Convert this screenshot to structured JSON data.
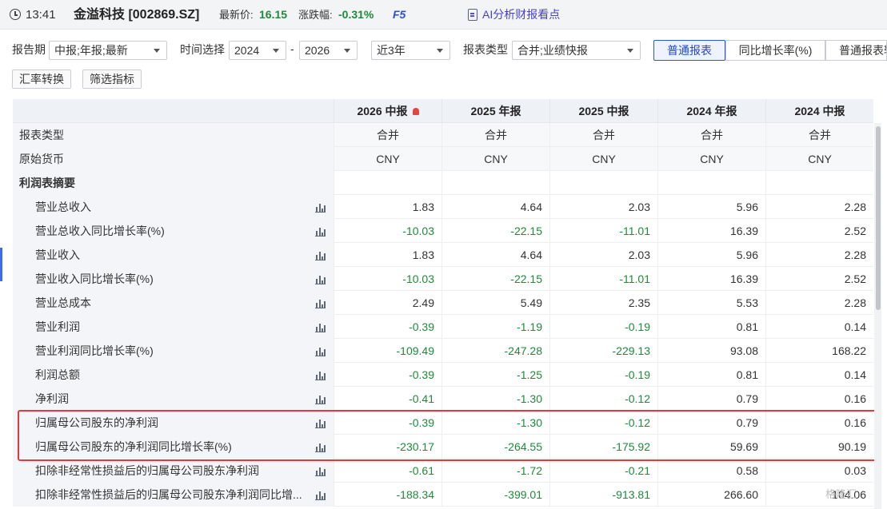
{
  "header": {
    "time": "13:41",
    "stock": "金溢科技 [002869.SZ]",
    "price_label": "最新价:",
    "price_value": "16.15",
    "change_label": "涨跌幅:",
    "change_value": "-0.31%",
    "f5": "F5",
    "ai_link": "AI分析财报看点"
  },
  "filters": {
    "period_label": "报告期",
    "period_value": "中报;年报;最新",
    "time_label": "时间选择",
    "year_from": "2024",
    "dash": "-",
    "year_to": "2026",
    "range_value": "近3年",
    "type_label": "报表类型",
    "type_value": "合并;业绩快报",
    "tabs": [
      "普通报表",
      "同比增长率(%)",
      "普通报表转"
    ]
  },
  "buttons": {
    "currency": "汇率转换",
    "filter": "筛选指标"
  },
  "table": {
    "columns": [
      "2026 中报",
      "2025 年报",
      "2025 中报",
      "2024 年报",
      "2024 中报"
    ],
    "rows": [
      {
        "label": "报表类型",
        "values": [
          "合并",
          "合并",
          "合并",
          "合并",
          "合并"
        ]
      },
      {
        "label": "原始货币",
        "values": [
          "CNY",
          "CNY",
          "CNY",
          "CNY",
          "CNY"
        ]
      },
      {
        "label": "利润表摘要",
        "values": [
          "",
          "",
          "",
          "",
          ""
        ]
      },
      {
        "label": "营业总收入",
        "values": [
          "1.83",
          "4.64",
          "2.03",
          "5.96",
          "2.28"
        ]
      },
      {
        "label": "营业总收入同比增长率(%)",
        "values": [
          "-10.03",
          "-22.15",
          "-11.01",
          "16.39",
          "2.52"
        ]
      },
      {
        "label": "营业收入",
        "values": [
          "1.83",
          "4.64",
          "2.03",
          "5.96",
          "2.28"
        ]
      },
      {
        "label": "营业收入同比增长率(%)",
        "values": [
          "-10.03",
          "-22.15",
          "-11.01",
          "16.39",
          "2.52"
        ]
      },
      {
        "label": "营业总成本",
        "values": [
          "2.49",
          "5.49",
          "2.35",
          "5.53",
          "2.28"
        ]
      },
      {
        "label": "营业利润",
        "values": [
          "-0.39",
          "-1.19",
          "-0.19",
          "0.81",
          "0.14"
        ]
      },
      {
        "label": "营业利润同比增长率(%)",
        "values": [
          "-109.49",
          "-247.28",
          "-229.13",
          "93.08",
          "168.22"
        ]
      },
      {
        "label": "利润总额",
        "values": [
          "-0.39",
          "-1.25",
          "-0.19",
          "0.81",
          "0.14"
        ]
      },
      {
        "label": "净利润",
        "values": [
          "-0.41",
          "-1.30",
          "-0.12",
          "0.79",
          "0.16"
        ]
      },
      {
        "label": "归属母公司股东的净利润",
        "values": [
          "-0.39",
          "-1.30",
          "-0.12",
          "0.79",
          "0.16"
        ]
      },
      {
        "label": "归属母公司股东的净利润同比增长率(%)",
        "values": [
          "-230.17",
          "-264.55",
          "-175.92",
          "59.69",
          "90.19"
        ]
      },
      {
        "label": "扣除非经常性损益后的归属母公司股东净利润",
        "values": [
          "-0.61",
          "-1.72",
          "-0.21",
          "0.58",
          "0.03"
        ]
      },
      {
        "label": "扣除非经常性损益后的归属母公司股东净利润同比增...",
        "values": [
          "-188.34",
          "-399.01",
          "-913.81",
          "266.60",
          "104.06"
        ]
      }
    ]
  },
  "watermark": "格隆汇",
  "colors": {
    "negative": "#1e8a3a",
    "accent": "#2b56d6",
    "highlight_border": "#e23a3a"
  }
}
